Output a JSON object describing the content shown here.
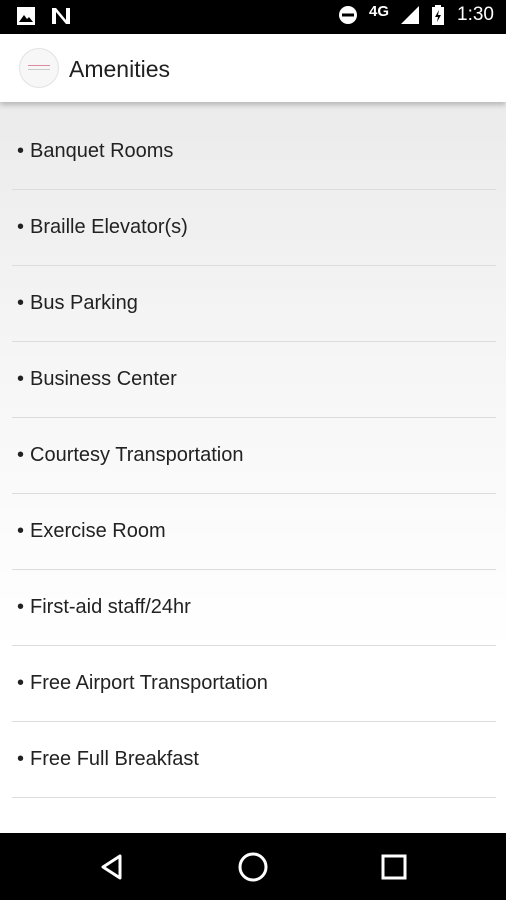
{
  "status_bar": {
    "network": "4G",
    "time": "1:30",
    "icons": [
      "image-icon",
      "n-app-icon",
      "do-not-disturb-icon",
      "signal-icon",
      "battery-icon"
    ]
  },
  "app_bar": {
    "title": "Amenities",
    "logo_icon": "hotel-logo-icon"
  },
  "amenities": [
    {
      "label": "Banquet Rooms"
    },
    {
      "label": "Braille Elevator(s)"
    },
    {
      "label": "Bus Parking"
    },
    {
      "label": "Business Center"
    },
    {
      "label": "Courtesy Transportation"
    },
    {
      "label": "Exercise Room"
    },
    {
      "label": "First-aid staff/24hr"
    },
    {
      "label": "Free Airport Transportation"
    },
    {
      "label": "Free Full Breakfast"
    }
  ],
  "bullet": "•",
  "nav_bar": {
    "icons": [
      "back-icon",
      "home-icon",
      "recents-icon"
    ]
  },
  "colors": {
    "status_bar": "#000000",
    "app_bar": "#ffffff",
    "text": "#222222",
    "divider": "#dcdcdc"
  }
}
